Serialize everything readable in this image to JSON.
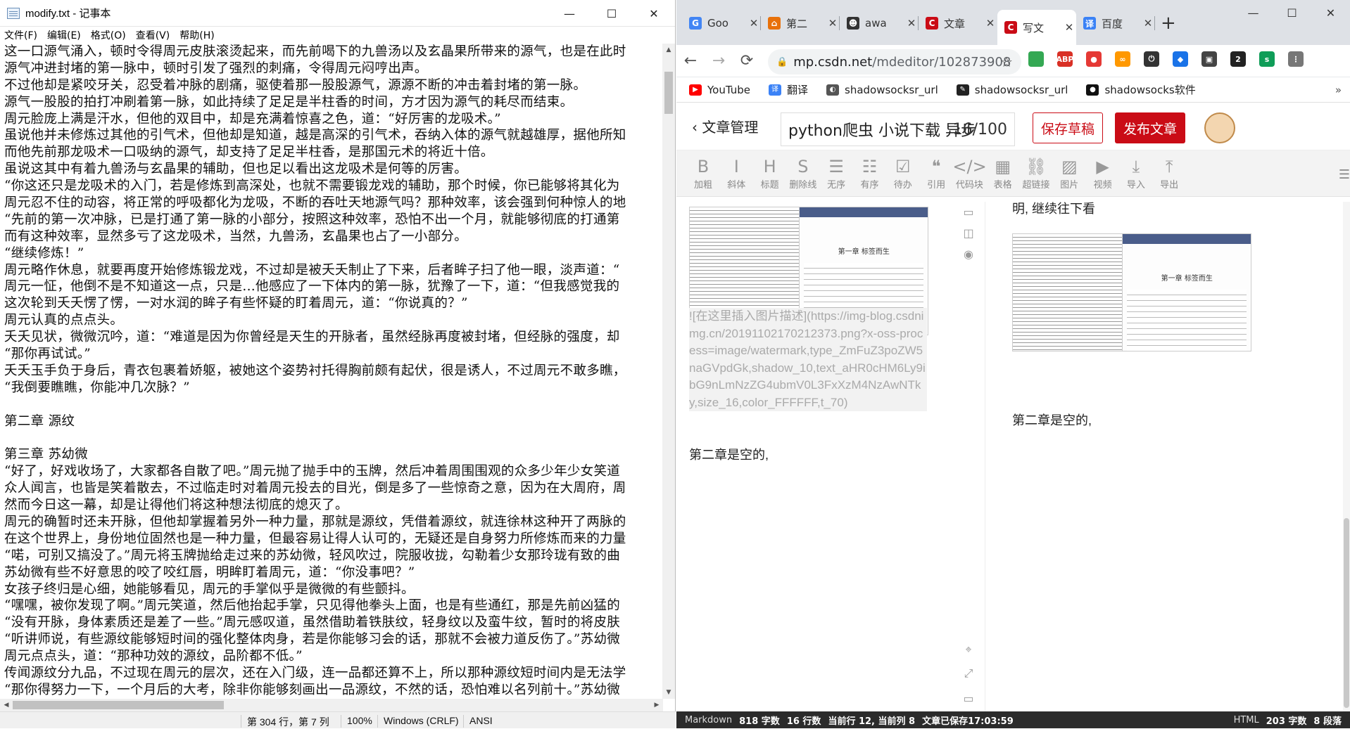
{
  "notepad": {
    "title": "modify.txt - 记事本",
    "menus": [
      "文件(F)",
      "编辑(E)",
      "格式(O)",
      "查看(V)",
      "帮助(H)"
    ],
    "lines": [
      "这一口源气涌入，顿时令得周元皮肤滚烫起来，而先前喝下的九兽汤以及玄晶果所带来的源气，也是在此时",
      "源气冲进封堵的第一脉中，顿时引发了强烈的刺痛，令得周元闷哼出声。",
      "不过他却是紧咬牙关，忍受着冲脉的剧痛，驱使着那一股股源气，源源不断的冲击着封堵的第一脉。",
      "源气一股股的拍打冲刷着第一脉，如此持续了足足是半柱香的时间，方才因为源气的耗尽而结束。",
      "周元脸庞上满是汗水，但他的双目中，却是充满着惊喜之色，道：“好厉害的龙吸术。”",
      "虽说他并未修炼过其他的引气术，但他却是知道，越是高深的引气术，吞纳入体的源气就越雄厚，据他所知",
      "而他先前那龙吸术一口吸纳的源气，却支持了足足半柱香，是那国元术的将近十倍。",
      "虽说这其中有着九兽汤与玄晶果的辅助，但也足以看出这龙吸术是何等的厉害。",
      "“你这还只是龙吸术的入门，若是修炼到高深处，也就不需要锻龙戏的辅助，那个时候，你已能够将其化为",
      "周元忍不住的动容，将正常的呼吸都化为龙吸，不断的吞吐天地源气吗？那种效率，该会强到何种惊人的地",
      "“先前的第一次冲脉，已是打通了第一脉的小部分，按照这种效率，恐怕不出一个月，就能够彻底的打通第",
      "而有这种效率，显然多亏了这龙吸术，当然，九兽汤，玄晶果也占了一小部分。",
      "“继续修炼！”",
      "周元略作休息，就要再度开始修炼锻龙戏，不过却是被夭夭制止了下来，后者眸子扫了他一眼，淡声道：“",
      "周元一怔，他倒不是不知道这一点，只是...他感应了一下体内的第一脉，犹豫了一下，道：“但我感觉我的",
      "这次轮到夭夭愣了愣，一对水润的眸子有些怀疑的盯着周元，道：“你说真的？”",
      "周元认真的点点头。",
      "夭夭见状，微微沉吟，道：“难道是因为你曾经是天生的开脉者，虽然经脉再度被封堵，但经脉的强度，却",
      "“那你再试试。”",
      "夭夭玉手负于身后，青衣包裹着娇躯，被她这个姿势衬托得胸前颇有起伏，很是诱人，不过周元不敢多瞧，",
      "“我倒要瞧瞧，你能冲几次脉？”",
      "",
      "第二章 源纹",
      "",
      "第三章 苏幼微",
      "“好了，好戏收场了，大家都各自散了吧。”周元抛了抛手中的玉牌，然后冲着周围围观的众多少年少女笑道",
      "众人闻言，也皆是笑着散去，不过临走时对着周元投去的目光，倒是多了一些惊奇之意，因为在大周府，周",
      "然而今日这一幕，却是让得他们将这种想法彻底的熄灭了。",
      "周元的确暂时还未开脉，但他却掌握着另外一种力量，那就是源纹，凭借着源纹，就连徐林这种开了两脉的",
      "在这个世界上，身份地位固然也是一种力量，但最容易让得人认可的，无疑还是自身努力所修炼而来的力量",
      "“喏，可别又搞没了。”周元将玉牌抛给走过来的苏幼微，轻风吹过，院服收拢，勾勒着少女那玲珑有致的曲",
      "苏幼微有些不好意思的咬了咬红唇，明眸盯着周元，道：“你没事吧？”",
      "女孩子终归是心细，她能够看见，周元的手掌似乎是微微的有些颤抖。",
      "“嘿嘿，被你发现了啊。”周元笑道，然后他抬起手掌，只见得他拳头上面，也是有些通红，那是先前凶猛的",
      "“没有开脉，身体素质还是差了一些。”周元感叹道，虽然借助着铁肤纹，轻身纹以及蛮牛纹，暂时的将皮肤",
      "“听讲师说，有些源纹能够短时间的强化整体肉身，若是你能够习会的话，那就不会被力道反伤了。”苏幼微",
      "周元点点头，道：“那种功效的源纹，品阶都不低。”",
      "传闻源纹分九品，不过现在周元的层次，还在入门级，连一品都还算不上，所以那种源纹短时间内是无法学",
      "“那你得努力一下，一个月后的大考，除非你能够刻画出一品源纹，不然的话，恐怕难以名列前十。”苏幼微"
    ],
    "status": {
      "pos": "第 304 行，第 7 列",
      "zoom": "100%",
      "eol": "Windows (CRLF)",
      "enc": "ANSI"
    },
    "winbtns": [
      "—",
      "☐",
      "✕"
    ]
  },
  "chrome": {
    "tabs": [
      {
        "label": "Goo",
        "icon": "G",
        "color": "#4285f4"
      },
      {
        "label": "第二",
        "icon": "⌂",
        "color": "#e8710a"
      },
      {
        "label": "awa",
        "icon": "☻",
        "color": "#333333"
      },
      {
        "label": "文章",
        "icon": "C",
        "color": "#ca0c16"
      },
      {
        "label": "写文",
        "icon": "C",
        "color": "#ca0c16"
      },
      {
        "label": "百度",
        "icon": "译",
        "color": "#3b82f6"
      }
    ],
    "close_glyph": "✕",
    "newtab": "+",
    "nav": {
      "back": "←",
      "forward": "→",
      "reload": "⟳"
    },
    "url_host": "mp.csdn.net",
    "url_path": "/mdeditor/102873908",
    "lock": "🔒",
    "star": "☆",
    "extensions": [
      {
        "label": "",
        "color": "#34a853"
      },
      {
        "label": "ABP",
        "color": "#d93025"
      },
      {
        "label": "●",
        "color": "#e53935"
      },
      {
        "label": "∞",
        "color": "#ff9800"
      },
      {
        "label": "⏻",
        "color": "#333333"
      },
      {
        "label": "◆",
        "color": "#1a73e8"
      },
      {
        "label": "▣",
        "color": "#444444"
      },
      {
        "label": "2",
        "color": "#222222"
      },
      {
        "label": "s",
        "color": "#0f9d58"
      },
      {
        "label": "⋮",
        "color": "#777777"
      }
    ],
    "bookmarks": [
      {
        "label": "YouTube",
        "color": "#ff0000",
        "icon": "▶"
      },
      {
        "label": "翻译",
        "color": "#3b82f6",
        "icon": "译"
      },
      {
        "label": "shadowsocksr_url",
        "color": "#555555",
        "icon": "◐"
      },
      {
        "label": "shadowsocksr_url",
        "color": "#222222",
        "icon": "✎"
      },
      {
        "label": "shadowsocks软件",
        "color": "#111111",
        "icon": "●"
      }
    ],
    "bookmarks_more": "»",
    "editor": {
      "back_label": "文章管理",
      "title_value": "python爬虫 小说下载 异步",
      "title_count": "16/100",
      "save_draft": "保存草稿",
      "publish": "发布文章"
    },
    "tools": [
      {
        "g": "B",
        "t": "加粗",
        "name": "bold"
      },
      {
        "g": "I",
        "t": "斜体",
        "name": "italic"
      },
      {
        "g": "H",
        "t": "标题",
        "name": "heading"
      },
      {
        "g": "S",
        "t": "删除线",
        "name": "strikethrough"
      },
      {
        "g": "☰",
        "t": "无序",
        "name": "unordered-list"
      },
      {
        "g": "☷",
        "t": "有序",
        "name": "ordered-list"
      },
      {
        "g": "☑",
        "t": "待办",
        "name": "todo"
      },
      {
        "g": "❝",
        "t": "引用",
        "name": "quote"
      },
      {
        "g": "</>",
        "t": "代码块",
        "name": "code-block"
      },
      {
        "g": "▦",
        "t": "表格",
        "name": "table"
      },
      {
        "g": "⛓",
        "t": "超链接",
        "name": "link"
      },
      {
        "g": "▨",
        "t": "图片",
        "name": "image"
      },
      {
        "g": "▶",
        "t": "视频",
        "name": "video"
      },
      {
        "g": "⤓",
        "t": "导入",
        "name": "import"
      },
      {
        "g": "⤒",
        "t": "导出",
        "name": "export"
      }
    ],
    "md_image_text": "![在这里插入图片描述](https://img-blog.csdnimg.cn/20191102170212373.png?x-oss-process=image/watermark,type_ZmFuZ3poZW5naGVpdGk,shadow_10,text_aHR0cHM6Ly9ibG9nLmNzZG4ubmV0L3FxXzM4NzAwNTky,size_16,color_FFFFFF,t_70)",
    "md_para": "第二章是空的,",
    "preview_top": "明, 继续往下看",
    "preview_para": "第二章是空的,",
    "thumb_caption": "第一章 标签而生",
    "status": {
      "left": "Markdown",
      "chars": "818 字数",
      "lines": "16 行数",
      "cur": "当前行 12, 当前列 8",
      "saved": "文章已保存17:03:59",
      "html": "HTML",
      "hchars": "203 字数",
      "paras": "8 段落"
    },
    "winbtns": [
      "—",
      "☐",
      "✕"
    ]
  }
}
